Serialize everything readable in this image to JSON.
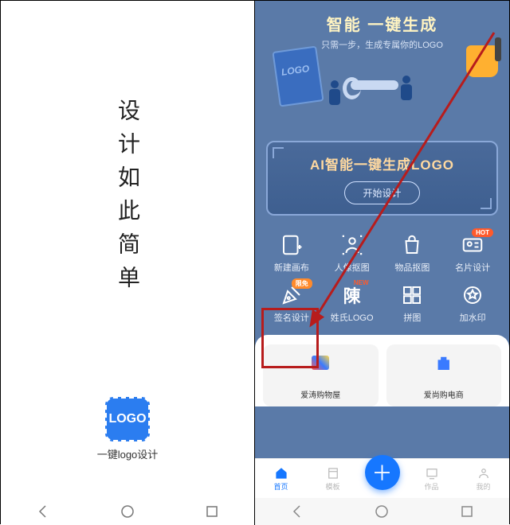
{
  "left": {
    "slogan": "设计如此简单",
    "logo_text": "LOGO",
    "logo_label": "一键logo设计"
  },
  "hero": {
    "title": "智能 一键生成",
    "subtitle": "只需一步，生成专属你的LOGO"
  },
  "ai_banner": {
    "title": "AI智能一键生成LOGO",
    "button": "开始设计"
  },
  "tools_row1": [
    {
      "label": "新建画布",
      "badge": ""
    },
    {
      "label": "人像抠图",
      "badge": ""
    },
    {
      "label": "物品抠图",
      "badge": ""
    },
    {
      "label": "名片设计",
      "badge": "HOT"
    }
  ],
  "tools_row2": [
    {
      "label": "签名设计",
      "badge": "限免"
    },
    {
      "label": "姓氏LOGO",
      "badge": "NEW",
      "sample": "陳"
    },
    {
      "label": "拼图",
      "badge": ""
    },
    {
      "label": "加水印",
      "badge": ""
    }
  ],
  "cards": [
    {
      "label": "爱涛购物屋"
    },
    {
      "label": "爱尚购电商"
    }
  ],
  "tabs": {
    "home": "首页",
    "tpl": "模板",
    "works": "作品",
    "mine": "我的"
  }
}
